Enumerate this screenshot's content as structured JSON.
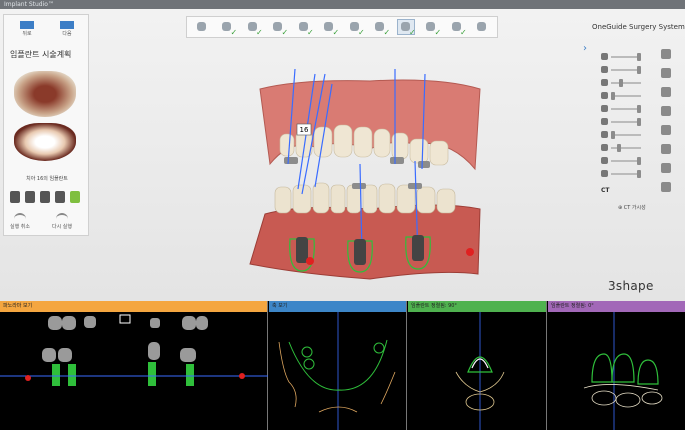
{
  "window": {
    "title": "Implant Studio™"
  },
  "nav": {
    "back_label": "뒤로",
    "next_label": "다음"
  },
  "panel": {
    "title": "임플란트 시술계획",
    "implant_caption": "치아 16의 임플란트",
    "undo_label": "실행 취소",
    "redo_label": "다시 실행"
  },
  "toolbar": {
    "tools": [
      {
        "icon": "hand-icon",
        "done": false
      },
      {
        "icon": "scan-icon",
        "done": true
      },
      {
        "icon": "align-icon",
        "done": true
      },
      {
        "icon": "tooth-icon",
        "done": true
      },
      {
        "icon": "crosssection-icon",
        "done": true
      },
      {
        "icon": "crown-icon",
        "done": true
      },
      {
        "icon": "implant-icon",
        "done": true
      },
      {
        "icon": "sleeve-icon",
        "done": true
      },
      {
        "icon": "guide-icon",
        "done": true
      },
      {
        "icon": "drill-icon",
        "done": true
      },
      {
        "icon": "export-icon",
        "done": true
      },
      {
        "icon": "print-icon",
        "done": false
      }
    ],
    "check_mark": "✓"
  },
  "brand": "OneGuide Surgery System",
  "expand_icon": "›",
  "visibility": {
    "ct_label": "CT",
    "ct_visibility_label": "CT 가시성",
    "ct_toggle_icon": "⊕"
  },
  "viewport": {
    "tooth_number": "16"
  },
  "logo": "3shape",
  "bottom_panes": [
    {
      "title": "파노라마 보기",
      "color": "#f4a640"
    },
    {
      "title": "축 보기",
      "color": "#3d86c8"
    },
    {
      "title": "임플란트 정렬됨: 90°",
      "color": "#4fb24f"
    },
    {
      "title": "임플란트 정렬됨: 0°",
      "color": "#a268b8"
    }
  ],
  "colors": {
    "accent": "#3d7ec6",
    "done": "#3aa03a",
    "implant_green": "#2fbf3b",
    "axis_blue": "#3a6cff",
    "marker_red": "#e02020"
  }
}
